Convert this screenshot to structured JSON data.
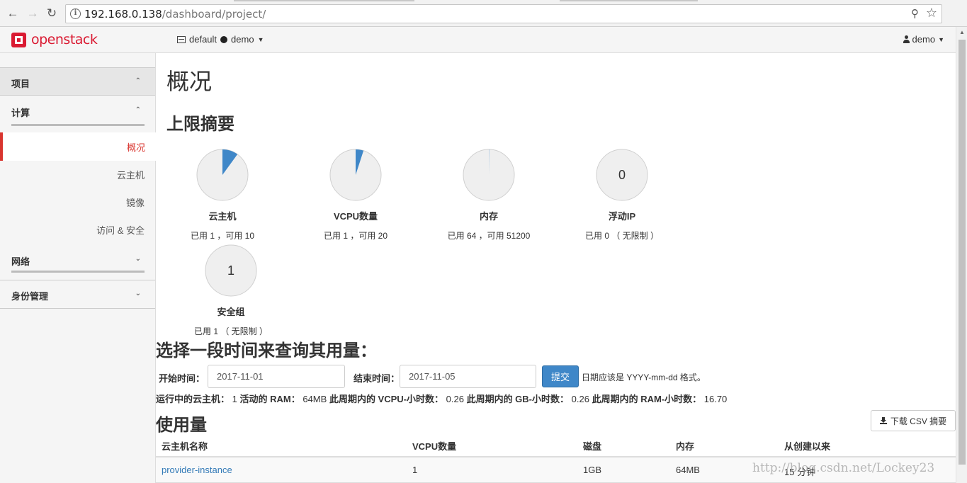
{
  "browser": {
    "url_host": "192.168.0.138",
    "url_path": "/dashboard/project/"
  },
  "topnav": {
    "brand": "openstack",
    "domain": "default",
    "project": "demo",
    "user": "demo"
  },
  "sidebar": {
    "project": "项目",
    "compute": "计算",
    "items": [
      "概况",
      "云主机",
      "镜像",
      "访问 & 安全"
    ],
    "network": "网络",
    "identity": "身份管理"
  },
  "main": {
    "page_title": "概况",
    "limits_title": "上限摘要",
    "pies": [
      {
        "label": "云主机",
        "sub": "已用 1 ，可用 10",
        "used": 1,
        "limit": 10,
        "center": ""
      },
      {
        "label": "VCPU数量",
        "sub": "已用 1 ，可用 20",
        "used": 1,
        "limit": 20,
        "center": ""
      },
      {
        "label": "内存",
        "sub": "已用 64 ，可用 51200",
        "used": 64,
        "limit": 51200,
        "center": ""
      },
      {
        "label": "浮动IP",
        "sub": "已用 0 （ 无限制 ）",
        "used": 0,
        "limit": 0,
        "center": "0"
      },
      {
        "label": "安全组",
        "sub": "已用 1 （ 无限制 ）",
        "used": 1,
        "limit": 0,
        "center": "1"
      }
    ],
    "query_title": "选择一段时间来查询其用量：",
    "start_label": "开始时间：",
    "start_value": "2017-11-01",
    "end_label": "结束时间：",
    "end_value": "2017-11-05",
    "submit_label": "提交",
    "date_hint": "日期应该是 YYYY-mm-dd 格式。",
    "summary": {
      "instances_label": "运行中的云主机：",
      "instances_value": "1",
      "ram_label": "活动的 RAM：",
      "ram_value": "64MB",
      "vcpu_label": "此周期内的 VCPU-小时数：",
      "vcpu_value": "0.26",
      "gb_label": "此周期内的 GB-小时数：",
      "gb_value": "0.26",
      "ramh_label": "此周期内的 RAM-小时数：",
      "ramh_value": "16.70"
    },
    "usage_title": "使用量",
    "csv_label": "下载 CSV 摘要",
    "table": {
      "headers": [
        "云主机名称",
        "VCPU数量",
        "磁盘",
        "内存",
        "从创建以来"
      ],
      "rows": [
        {
          "name": "provider-instance",
          "vcpu": "1",
          "disk": "1GB",
          "ram": "64MB",
          "uptime": "15 分钟"
        }
      ]
    }
  },
  "watermark": "http://blog.csdn.net/Lockey23",
  "colors": {
    "accent": "#d9352f",
    "pie_fill": "#3f87c8",
    "pie_bg": "#efefef",
    "link": "#337ab7"
  }
}
